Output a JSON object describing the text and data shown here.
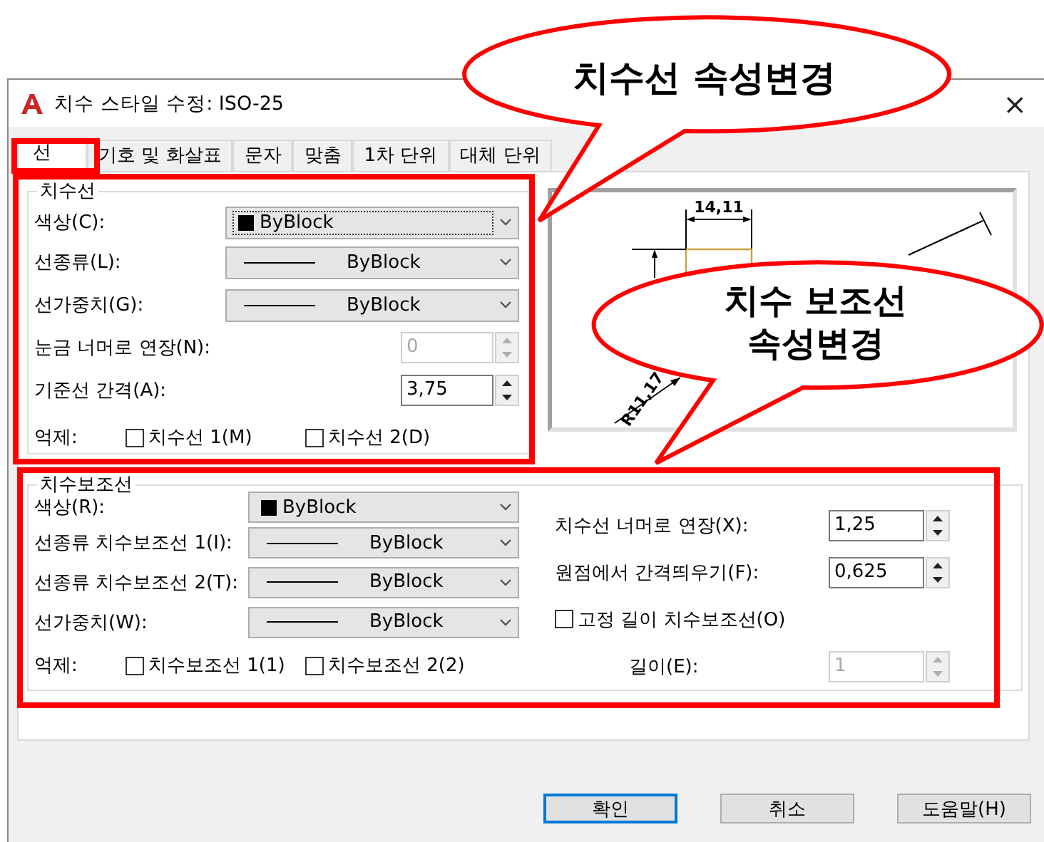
{
  "window": {
    "title": "치수 스타일 수정: ISO-25",
    "close": "×"
  },
  "tabs": [
    {
      "label": "선",
      "selected": true
    },
    {
      "label": "기호 및 화살표",
      "selected": false
    },
    {
      "label": "문자",
      "selected": false
    },
    {
      "label": "맞춤",
      "selected": false
    },
    {
      "label": "1차 단위",
      "selected": false
    },
    {
      "label": "대체 단위",
      "selected": false
    }
  ],
  "dimension_lines": {
    "title": "치수선",
    "fields": [
      {
        "kind": "color",
        "label": "색상(C):",
        "value": "ByBlock",
        "focused": true
      },
      {
        "kind": "linetype",
        "label": "선종류(L):",
        "value": "ByBlock",
        "focused": false
      },
      {
        "kind": "linetype",
        "label": "선가중치(G):",
        "value": "ByBlock",
        "focused": false
      },
      {
        "kind": "spin",
        "label": "눈금 너머로 연장(N):",
        "value": "0",
        "disabled": true
      },
      {
        "kind": "spin",
        "label": "기준선 간격(A):",
        "value": "3,75",
        "disabled": false
      }
    ],
    "suppress": {
      "label": "억제:",
      "options": [
        {
          "label": "치수선 1(M)",
          "checked": false
        },
        {
          "label": "치수선 2(D)",
          "checked": false
        }
      ]
    }
  },
  "preview": {
    "labels": [
      "14,11",
      "R11,17"
    ]
  },
  "extension_lines": {
    "title": "치수보조선",
    "fields": [
      {
        "kind": "color",
        "label": "색상(R):",
        "value": "ByBlock",
        "focused": false
      },
      {
        "kind": "linetype",
        "label": "선종류 치수보조선 1(I):",
        "value": "ByBlock",
        "focused": false
      },
      {
        "kind": "linetype",
        "label": "선종류 치수보조선 2(T):",
        "value": "ByBlock",
        "focused": false
      },
      {
        "kind": "linetype",
        "label": "선가중치(W):",
        "value": "ByBlock",
        "focused": false
      }
    ],
    "suppress": {
      "label": "억제:",
      "options": [
        {
          "label": "치수보조선 1(1)",
          "checked": false
        },
        {
          "label": "치수보조선 2(2)",
          "checked": false
        }
      ]
    },
    "settings": [
      {
        "kind": "spin",
        "label": "치수선 너머로 연장(X):",
        "value": "1,25",
        "disabled": false
      },
      {
        "kind": "spin",
        "label": "원점에서 간격띄우기(F):",
        "value": "0,625",
        "disabled": false
      },
      {
        "kind": "check",
        "label": "고정 길이 치수보조선(O)",
        "checked": false,
        "children": [
          {
            "kind": "spin",
            "label": "길이(E):",
            "value": "1",
            "disabled": true
          }
        ]
      }
    ]
  },
  "buttons": [
    {
      "label": "확인",
      "default": true
    },
    {
      "label": "취소",
      "default": false
    },
    {
      "label": "도움말(H)",
      "default": false
    }
  ],
  "callouts": [
    {
      "lines": [
        "치수선 속성변경"
      ]
    },
    {
      "lines": [
        "치수 보조선",
        "속성변경"
      ]
    }
  ]
}
